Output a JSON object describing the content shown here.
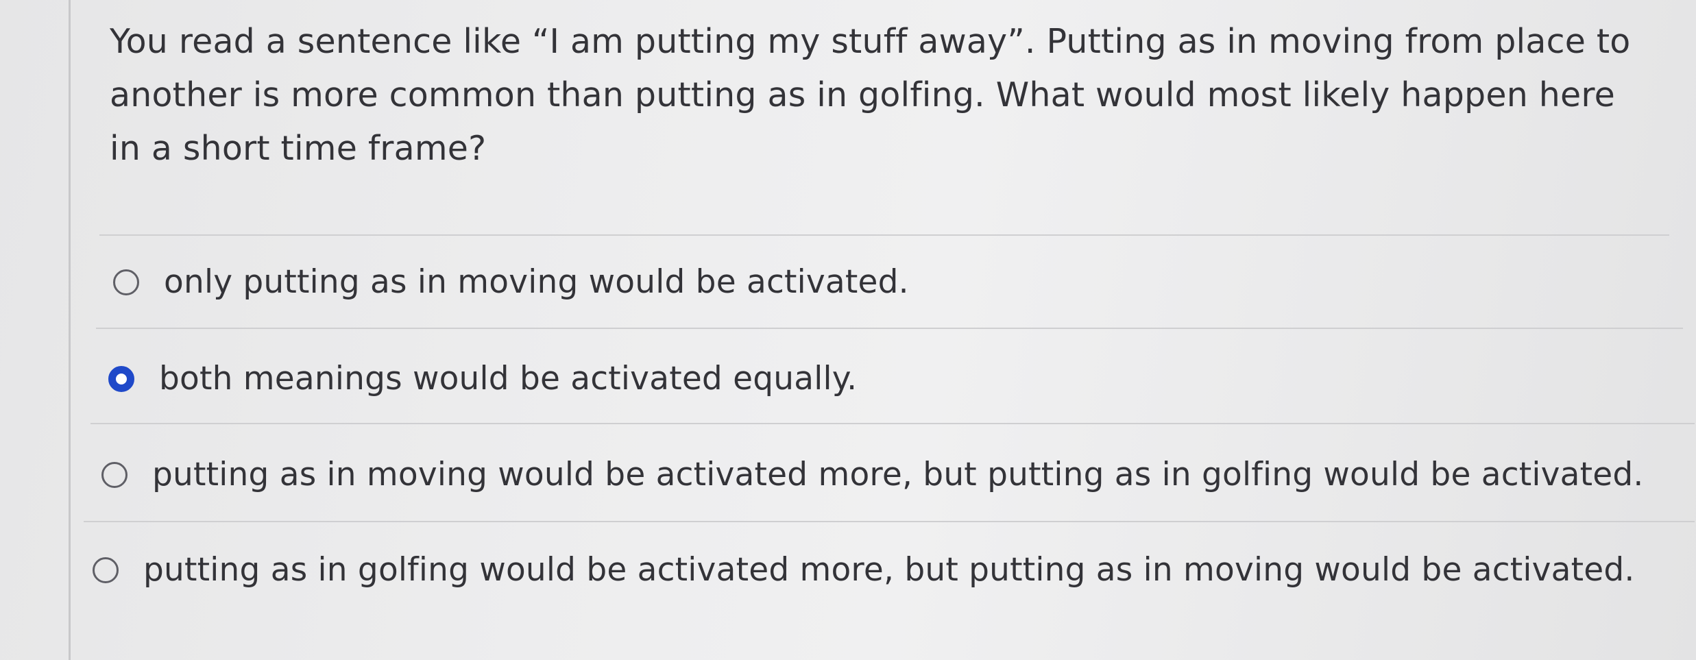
{
  "question": {
    "text": "You read a sentence like “I am putting my stuff away”. Putting as in moving from place to another is more common than putting as in golfing. What would most likely happen here in a short time frame?"
  },
  "options": [
    {
      "label": "only putting as in moving would be activated.",
      "selected": false
    },
    {
      "label": "both meanings would be activated equally.",
      "selected": true
    },
    {
      "label": "putting as in moving would be activated more, but putting as in golfing would be activated.",
      "selected": false
    },
    {
      "label": "putting as in golfing would be activated more, but putting as in moving would be activated.",
      "selected": false
    }
  ],
  "colors": {
    "selected_radio": "#1f49c9",
    "text": "#333338",
    "divider": "#cfcfd1"
  }
}
